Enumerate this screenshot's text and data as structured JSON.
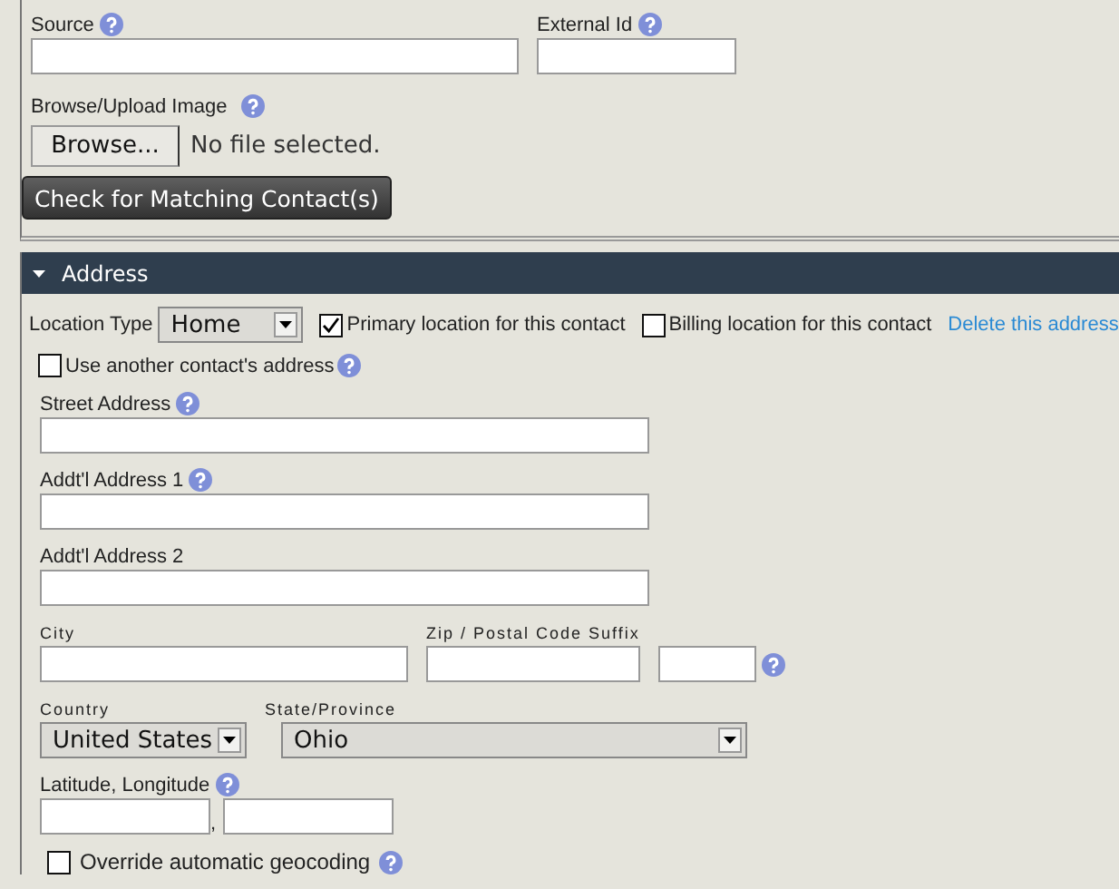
{
  "contact_fields": [
    {
      "label": "Source",
      "help": true
    },
    {
      "label": "External Id",
      "help": true
    }
  ],
  "image_upload": {
    "label": "Browse/Upload Image",
    "help": true,
    "button": "Browse...",
    "status": "No file selected."
  },
  "match_button": "Check for Matching Contact(s)",
  "address": {
    "title": "Address",
    "expanded": true,
    "location_type": {
      "label": "Location Type",
      "value": "Home"
    },
    "options": [
      {
        "label": "Primary location for this contact",
        "checked": true
      },
      {
        "label": "Billing location for this contact",
        "checked": false
      }
    ],
    "delete_link": "Delete this address",
    "use_other": {
      "label": "Use another contact's address",
      "checked": false,
      "help": true
    },
    "rows": [
      {
        "fields": [
          {
            "kind": "text",
            "label": "Street Address",
            "help": true
          }
        ]
      },
      {
        "fields": [
          {
            "kind": "text",
            "label": "Addt'l Address 1",
            "help": true
          }
        ]
      },
      {
        "fields": [
          {
            "kind": "text",
            "label": "Addt'l Address 2"
          }
        ]
      },
      {
        "fields": [
          {
            "kind": "text",
            "label": "City"
          },
          {
            "kind": "text",
            "label": "Zip / Postal Code Suffix"
          },
          {
            "kind": "text",
            "help": true
          }
        ]
      },
      {
        "fields": [
          {
            "kind": "select",
            "label": "Country",
            "value": "United States"
          },
          {
            "kind": "select",
            "label": "State/Province",
            "value": "Ohio"
          }
        ]
      },
      {
        "fields": [
          {
            "kind": "pair",
            "label": "Latitude, Longitude",
            "help": true,
            "separator": ","
          }
        ]
      },
      {
        "fields": [
          {
            "kind": "checkbox",
            "label": "Override automatic geocoding",
            "help": true,
            "checked": false
          }
        ]
      }
    ]
  }
}
